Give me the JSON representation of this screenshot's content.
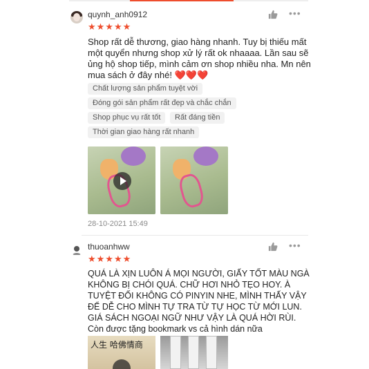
{
  "reviews": [
    {
      "username": "quynh_anh0912",
      "stars": "★★★★★",
      "comment": "Shop rất dễ thương, giao hàng nhanh. Tuy bị thiếu mất\nmột quyển nhưng shop xử lý rất ok nhaaaa. Lần sau sẽ\nủng hộ shop tiếp, mình cảm ơn shop nhiều nha. Mn nên\nmua sách ở đây nhé! ",
      "hearts": "❤️❤️❤️",
      "tags": [
        "Chất lượng sản phẩm tuyệt vời",
        "Đóng gói sản phẩm rất đẹp và chắc chắn",
        "Shop phục vụ rất tốt",
        "Rất đáng tiền",
        "Thời gian giao hàng rất nhanh"
      ],
      "timestamp": "28-10-2021 15:49"
    },
    {
      "username": "thuoanhww",
      "stars": "★★★★★",
      "comment": "QUÁ LÀ XỊN LUÔN Á MỌI NGƯỜI, GIẤY TỐT MÀU NGÀ\nKHÔNG BỊ CHÓI QUÁ. CHỮ HƠI NHỎ TẸO HOY. À\nTUYỆT ĐỐI KHÔNG CÓ PINYIN NHE, MÌNH THẤY VẬY\nĐỂ DỄ CHO MÌNH TỰ TRA TỪ TỰ HỌC TỪ MỚI LUN.\nGIÁ SÁCH NGOẠI NGỮ NHƯ VẬY LÀ QUÁ HỜI RÙI.\nCòn được tặng bookmark vs cả hình dán nữa",
      "media_text": "人生 哈佛情商"
    }
  ],
  "icons": {
    "like": "thumbs-up-icon",
    "more": "more-dots-icon",
    "play": "play-icon"
  },
  "colors": {
    "star": "#ee4d2d",
    "tag_bg": "#f1f1f1",
    "heart": "#e02020"
  }
}
